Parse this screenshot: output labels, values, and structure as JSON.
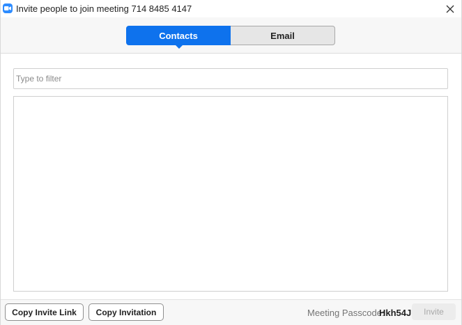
{
  "window": {
    "title": "Invite people to join meeting 714 8485 4147"
  },
  "tabs": [
    {
      "label": "Contacts",
      "selected": true
    },
    {
      "label": "Email",
      "selected": false
    }
  ],
  "filter": {
    "placeholder": "Type to filter",
    "value": ""
  },
  "contacts": [],
  "footer": {
    "copy_link_label": "Copy Invite Link",
    "copy_invitation_label": "Copy Invitation",
    "passcode_label": "Meeting Passcode:",
    "passcode_value": "Hkh54J",
    "invite_label": "Invite"
  },
  "colors": {
    "accent": "#0e72ed",
    "app_icon": "#2d8cff"
  },
  "icons": {
    "app": "zoom-camera-icon",
    "close": "close-icon"
  }
}
